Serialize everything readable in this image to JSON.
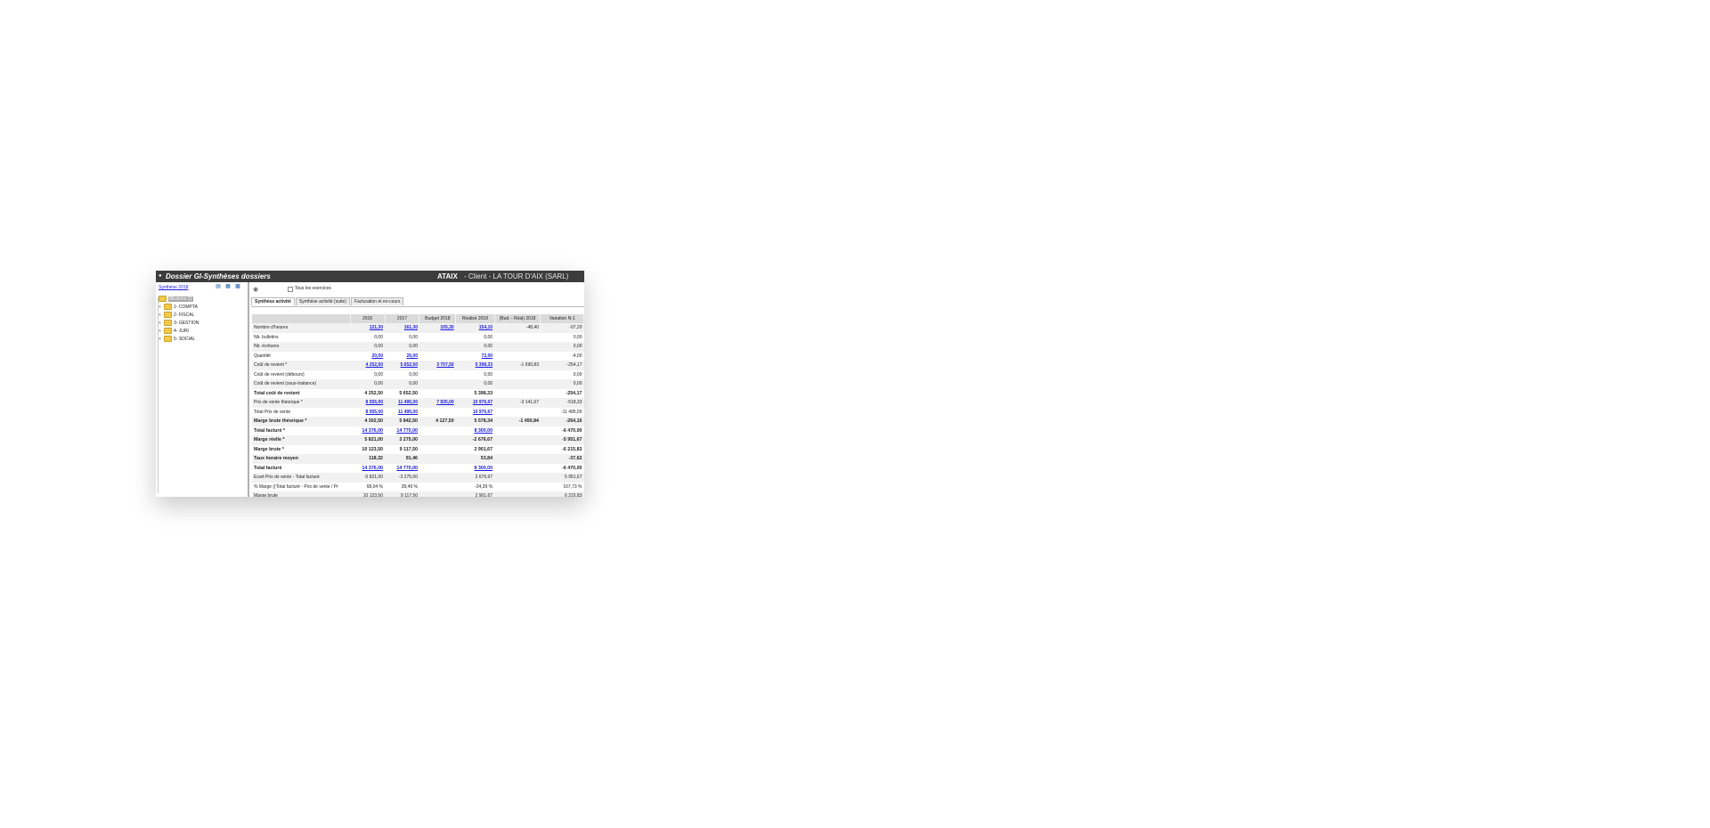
{
  "titlebar": {
    "menu_icon": "●",
    "title": "Dossier GI-Synthèses dossiers",
    "code": "ATAIX",
    "client": "- Client - LA TOUR D'AIX (SARL)"
  },
  "left": {
    "synthesis_link": "Synthèse 2018",
    "tree": {
      "root": "Missions (I)",
      "items": [
        "1- COMPTA",
        "2- FISCAL",
        "3- GESTION",
        "4- JURI",
        "5- SOCIAL"
      ],
      "expander": "+"
    }
  },
  "main": {
    "checkbox_label": "Tous les exercices",
    "checkbox_checked": false,
    "tabs": [
      "Synthèse activité",
      "Synthèse activité (suite)",
      "Facturation et en-cours"
    ],
    "active_tab": 0,
    "columns": [
      "",
      "2016",
      "2017",
      "Budget 2018",
      "Réalisé 2018",
      "(Bud. - Réal) 2018",
      "Variation N-1"
    ],
    "rows": [
      {
        "label": "Nombre d'heures",
        "v": [
          "121,30",
          "161,30",
          "105,30",
          "154,10",
          "-48,40",
          "-07,20"
        ],
        "links": [
          0,
          1,
          2,
          3
        ],
        "bold": false
      },
      {
        "label": "Nb. bulletins",
        "v": [
          "0,00",
          "0,00",
          "",
          "0,00",
          "",
          "0,00"
        ],
        "links": [],
        "bold": false
      },
      {
        "label": "Nb. écritures",
        "v": [
          "0,00",
          "0,00",
          "",
          "0,00",
          "",
          "0,00"
        ],
        "links": [],
        "bold": false
      },
      {
        "label": "Quantité",
        "v": [
          "20,00",
          "26,00",
          "",
          "72,00",
          "",
          "-4,00"
        ],
        "links": [
          0,
          1,
          3
        ],
        "bold": false
      },
      {
        "label": "Coût de revient *",
        "v": [
          "4 252,50",
          "5 652,50",
          "3 707,50",
          "5 398,33",
          "-1 690,83",
          "-254,17"
        ],
        "links": [
          0,
          1,
          2,
          3
        ],
        "bold": false
      },
      {
        "label": "Coût de revient (débours)",
        "v": [
          "0,00",
          "0,00",
          "",
          "0,00",
          "",
          "0,00"
        ],
        "links": [],
        "bold": false
      },
      {
        "label": "Coût de revient (sous-traitance)",
        "v": [
          "0,00",
          "0,00",
          "",
          "0,00",
          "",
          "0,00"
        ],
        "links": [],
        "bold": false
      },
      {
        "label": "Total coût de revient",
        "v": [
          "4 252,50",
          "5 652,50",
          "",
          "5 398,33",
          "",
          "-254,17"
        ],
        "links": [],
        "bold": true
      },
      {
        "label": "Prix de vente théorique *",
        "v": [
          "8 555,00",
          "11 495,00",
          "7 835,00",
          "10 976,67",
          "-3 141,67",
          "-518,33"
        ],
        "links": [
          0,
          1,
          2,
          3
        ],
        "bold": false
      },
      {
        "label": "Total Prix de vente",
        "v": [
          "8 555,00",
          "11 495,00",
          "",
          "10 976,67",
          "",
          "-11 495,00"
        ],
        "links": [
          0,
          1,
          3
        ],
        "bold": false
      },
      {
        "label": "Marge brute théorique *",
        "v": [
          "4 302,50",
          "5 842,50",
          "4 127,50",
          "5 578,34",
          "-1 450,84",
          "-264,16"
        ],
        "links": [],
        "bold": true
      },
      {
        "label": "Total facturé *",
        "v": [
          "14 376,00",
          "14 770,00",
          "",
          "8 300,00",
          "",
          "-6 470,00"
        ],
        "links": [
          0,
          1,
          3
        ],
        "bold": true
      },
      {
        "label": "Marge réelle *",
        "v": [
          "5 821,00",
          "3 275,00",
          "",
          "-2 676,67",
          "",
          "-5 951,67"
        ],
        "links": [],
        "bold": true
      },
      {
        "label": "Marge brute *",
        "v": [
          "10 123,50",
          "9 117,50",
          "",
          "2 901,67",
          "",
          "-6 215,83"
        ],
        "links": [],
        "bold": true
      },
      {
        "label": "Taux horaire moyen",
        "v": [
          "118,32",
          "91,46",
          "",
          "53,84",
          "",
          "-37,62"
        ],
        "links": [],
        "bold": true
      },
      {
        "label": "Total facturé",
        "v": [
          "14 376,00",
          "14 770,00",
          "",
          "8 300,00",
          "",
          "-6 470,00"
        ],
        "links": [
          0,
          1,
          3
        ],
        "bold": true
      },
      {
        "label": "Ecart Prix de vente - Total facturé",
        "v": [
          "-5 821,00",
          "-3 275,00",
          "",
          "2 676,67",
          "",
          "5 951,67"
        ],
        "links": [],
        "bold": false
      },
      {
        "label": "% Marge ((Total facturé - Prix de vente / Pr",
        "v": [
          "68,04 %",
          "28,49 %",
          "",
          "-24,39 %",
          "",
          "167,73 %"
        ],
        "links": [],
        "bold": false
      },
      {
        "label": "Marge brute",
        "v": [
          "10 123,50",
          "9 117,50",
          "",
          "2 901,67",
          "",
          "6 215,83"
        ],
        "links": [],
        "bold": false
      }
    ]
  }
}
